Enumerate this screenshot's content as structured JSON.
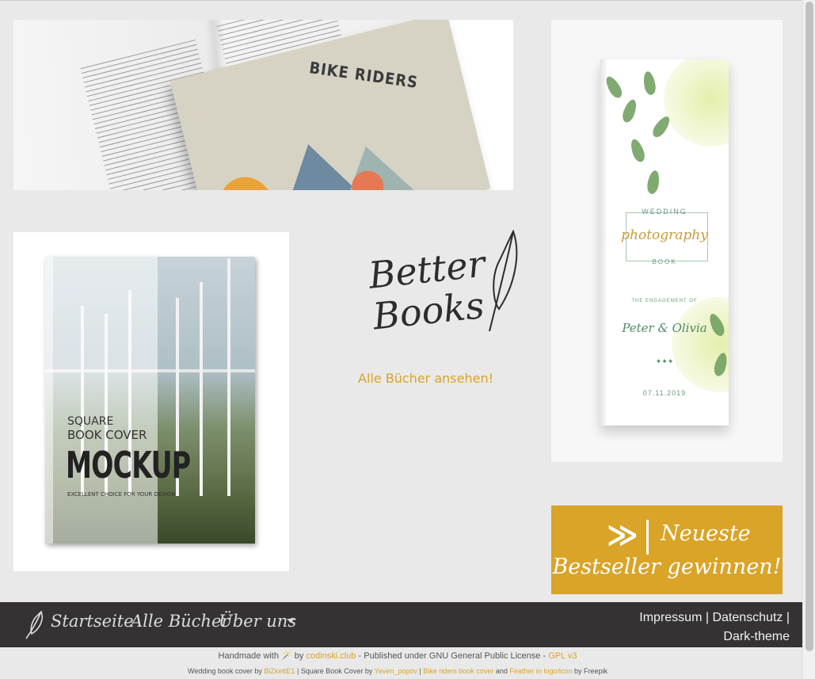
{
  "images": {
    "bike_cover_title": "BIKE RIDERS",
    "mockup": {
      "line1": "SQUARE",
      "line2": "BOOK COVER",
      "line3": "MOCKUP",
      "line4": "EXCELLENT CHOICE FOR YOUR DESIGN"
    },
    "wedding": {
      "line1": "WEDDING",
      "line2": "photography",
      "line3": "BOOK",
      "line4": "THE ENGAGEMENT OF",
      "line5": "Peter & Olivia",
      "line6": "07.11.2019"
    }
  },
  "logo": {
    "text_line1": "Better",
    "text_line2": "Books",
    "link_label": "Alle Bücher ansehen!"
  },
  "bestseller": {
    "arrow": "≫",
    "line1": "Neueste",
    "line2": "Bestseller gewinnen!"
  },
  "nav": {
    "items": [
      "Startseite",
      "Alle Bücher",
      "Über uns"
    ],
    "right_line1": "Impressum | Datenschutz |",
    "right_line2": "Dark-theme"
  },
  "credits": {
    "handmade": "Handmade with",
    "by": "by",
    "site": "codinski.club",
    "published": "- Published under GNU General Public License -",
    "license": "GPL v3",
    "wedding_label": "Wedding book cover by",
    "wedding_author": "BiZkettE1",
    "square_label": "| Square Book Cover by",
    "square_author": "Yeven_popov",
    "sep": "|",
    "bike_link": "Bike riders book cover",
    "and": "and",
    "feather_link": "Feather in logo/icon",
    "by_freepik": "by Freepik"
  }
}
